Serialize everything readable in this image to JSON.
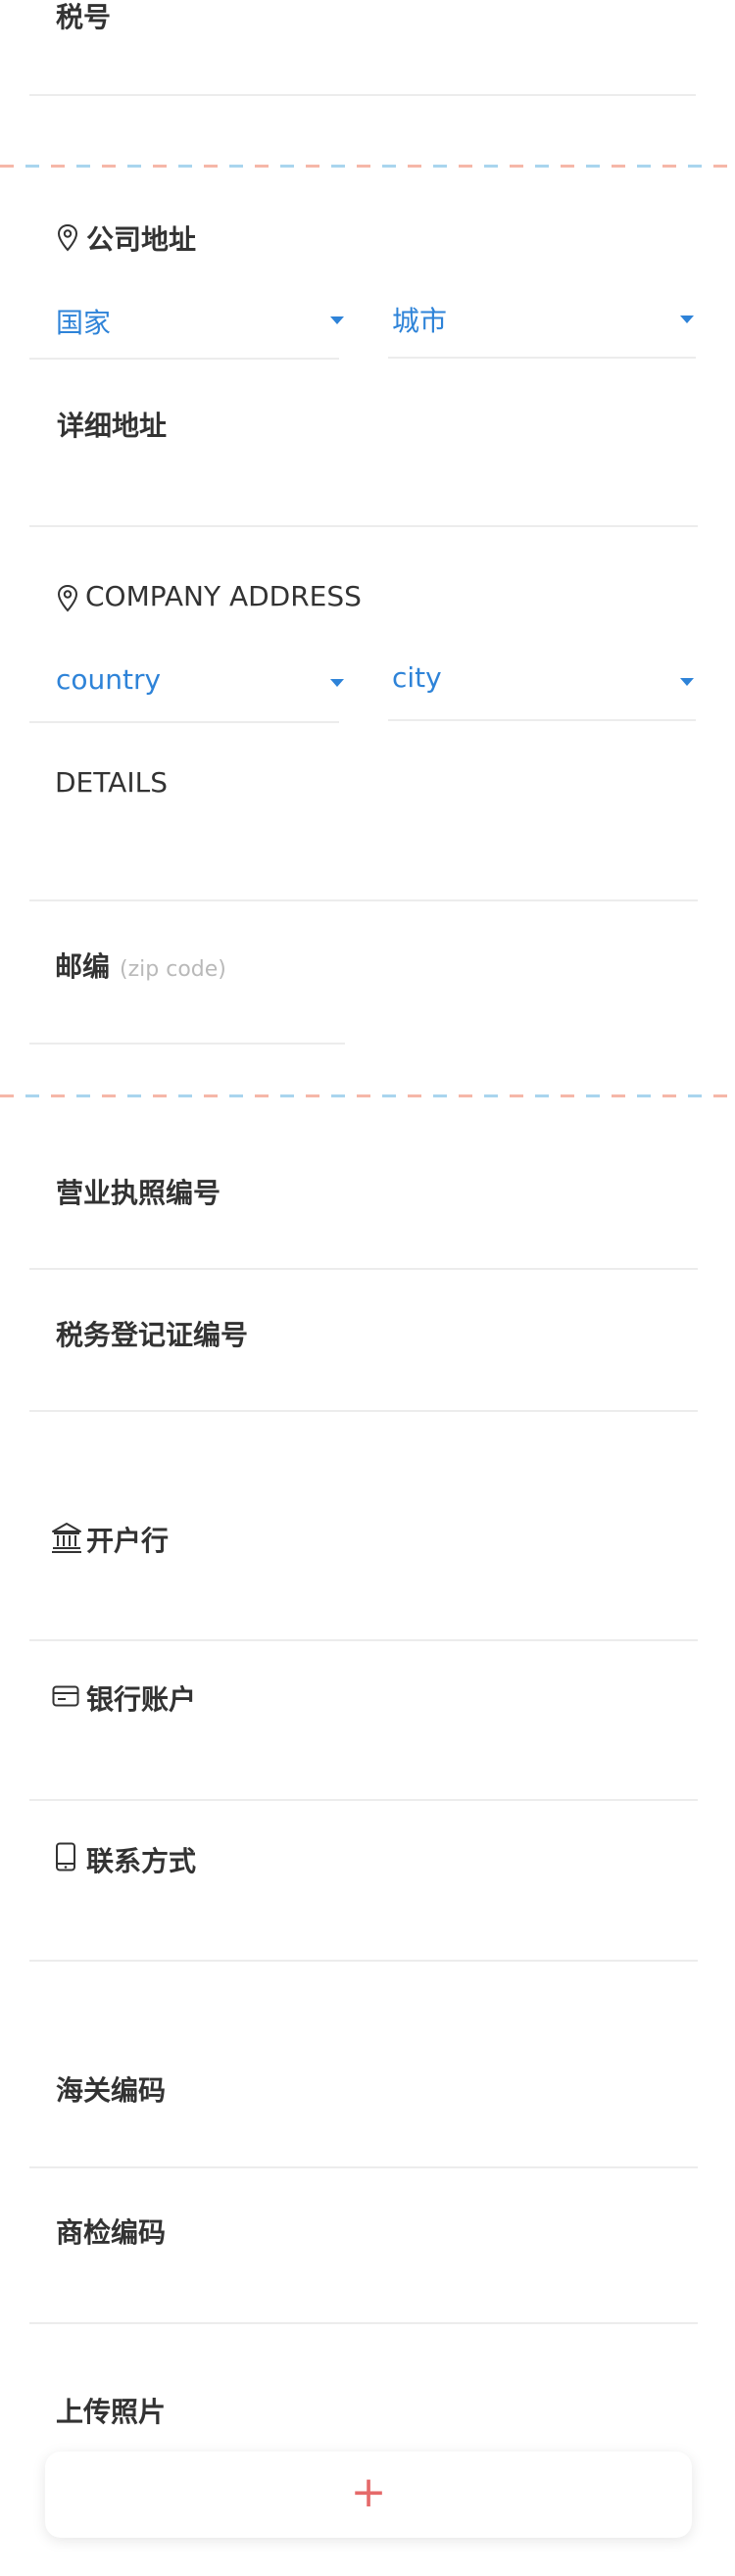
{
  "fields": {
    "tax_number": "税号",
    "company_address": "公司地址",
    "country_cn": "国家",
    "city_cn": "城市",
    "detail_address": "详细地址",
    "company_address_en": "COMPANY ADDRESS",
    "country_en": "country",
    "city_en": "city",
    "details_en": "DETAILS",
    "zip_label": "邮编",
    "zip_hint": "(zip code)",
    "business_license_no": "营业执照编号",
    "tax_registration_no": "税务登记证编号",
    "bank_name": "开户行",
    "bank_account": "银行账户",
    "contact": "联系方式",
    "customs_code": "海关编码",
    "inspection_code": "商检编码",
    "upload_photo": "上传照片"
  },
  "upload": {
    "plus": "+"
  },
  "colors": {
    "accent": "#2e83d8",
    "plus": "#e56a6a",
    "dash_orange": "#f6b7a8",
    "dash_blue": "#a9d5ee"
  },
  "icons": [
    "location-pin-icon",
    "bank-icon",
    "card-icon",
    "phone-icon",
    "dropdown-caret-icon"
  ]
}
